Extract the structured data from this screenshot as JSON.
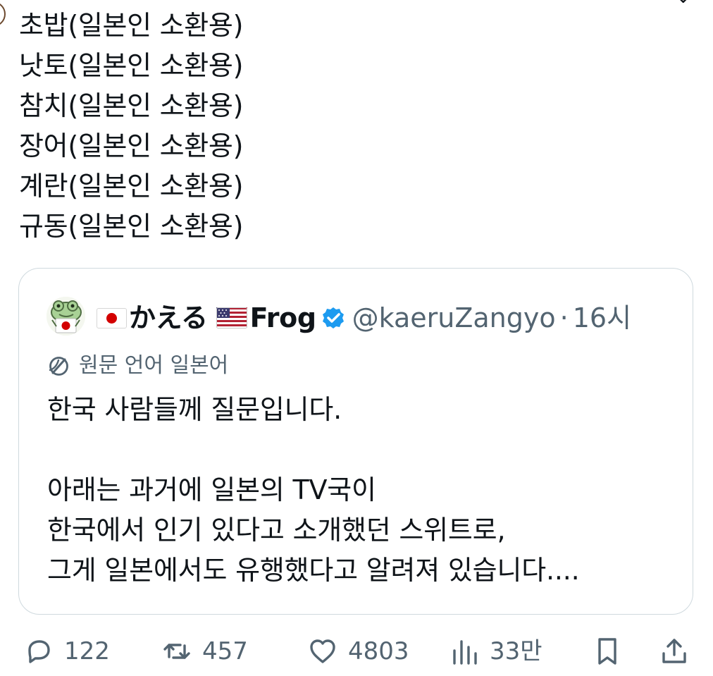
{
  "tweet": {
    "lines": [
      "초밥(일본인 소환용)",
      "낫토(일본인 소환용)",
      "참치(일본인 소환용)",
      "장어(일본인 소환용)",
      "계란(일본인 소환용)",
      "규동(일본인 소환용)"
    ]
  },
  "quote": {
    "display_name": "かえる",
    "display_name_suffix": "Frog",
    "handle": "@kaeruZangyo",
    "separator": "·",
    "time": "16시",
    "translation_note": "원문 언어 일본어",
    "text_lines": [
      "한국 사람들께 질문입니다.",
      "",
      "아래는 과거에 일본의 TV국이",
      "한국에서 인기 있다고 소개했던 스위트로,",
      "그게 일본에서도 유행했다고 알려져 있습니다...."
    ],
    "icons": {
      "avatar": "frog-avatar-icon",
      "japan_flag": "japan-flag-icon",
      "us_flag": "us-flag-icon",
      "verified": "verified-badge-icon",
      "translation": "translation-icon"
    },
    "colors": {
      "border": "#cfd9de",
      "verified": "#1d9bf0",
      "secondary_text": "#536471"
    }
  },
  "actions": {
    "reply_count": "122",
    "retweet_count": "457",
    "like_count": "4803",
    "views_count": "33만",
    "icons": {
      "reply": "reply-icon",
      "retweet": "retweet-icon",
      "like": "heart-icon",
      "views": "views-icon",
      "bookmark": "bookmark-icon",
      "share": "share-icon"
    }
  }
}
